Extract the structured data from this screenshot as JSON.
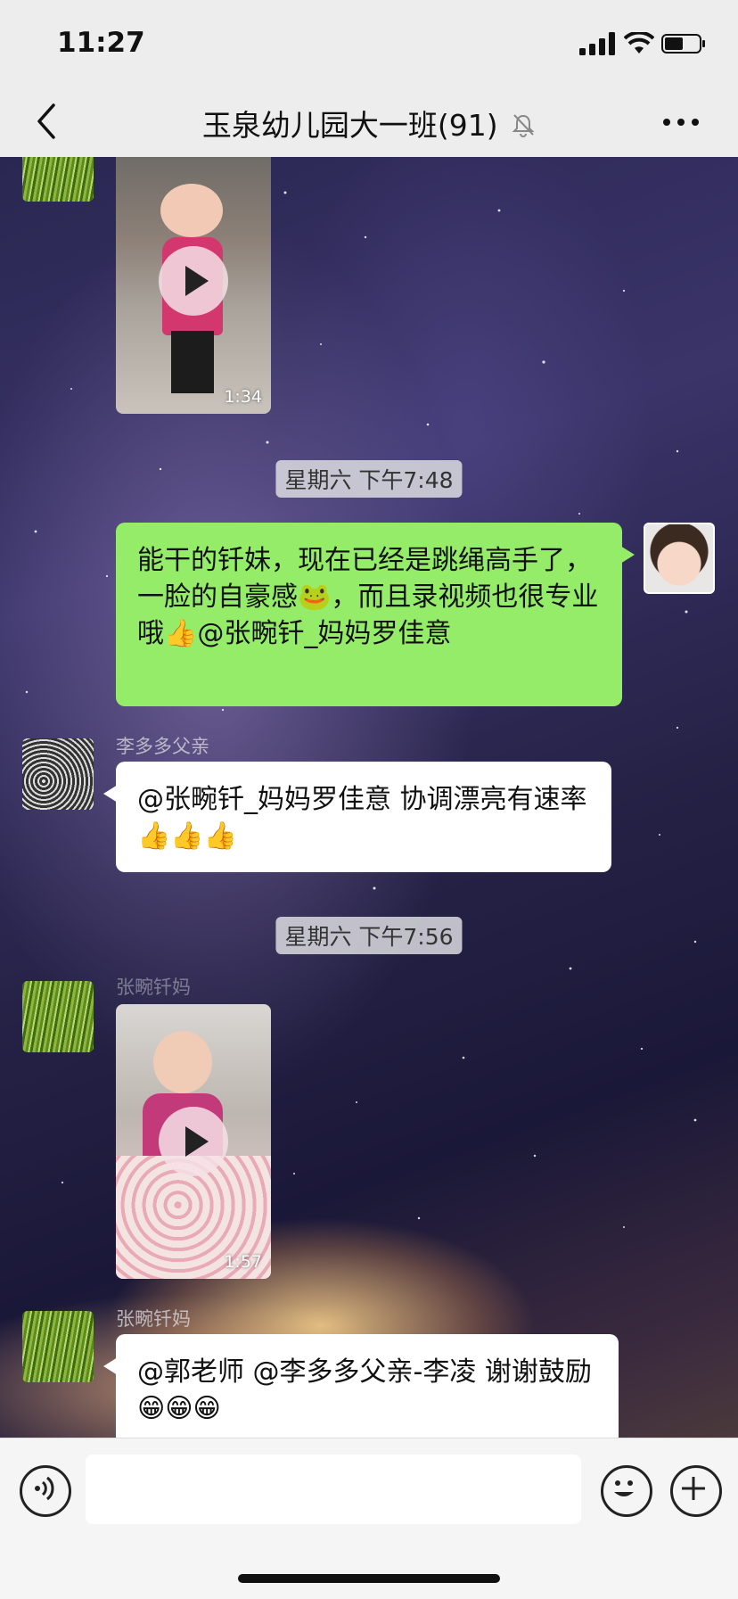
{
  "status_bar": {
    "time": "11:27"
  },
  "header": {
    "title": "玉泉幼儿园大一班(91)"
  },
  "messages": {
    "video1": {
      "duration": "1:34"
    },
    "timestamp1": "星期六 下午7:48",
    "out1": {
      "text": "能干的钎妹，现在已经是跳绳高手了，一脸的自豪感",
      "text2": "，而且录视频也很专业哦",
      "text3": "@张畹钎_妈妈罗佳意"
    },
    "in1": {
      "sender": "李多多父亲",
      "text": "@张畹钎_妈妈罗佳意 协调漂亮有速率"
    },
    "timestamp2": "星期六 下午7:56",
    "video2": {
      "sender": "张畹钎妈",
      "duration": "1:57"
    },
    "in2": {
      "sender": "张畹钎妈",
      "text": "@郭老师 @李多多父亲-李凌 谢谢鼓励"
    }
  },
  "icons": [
    "signal-icon",
    "wifi-icon",
    "battery-icon",
    "back-icon",
    "mute-icon",
    "more-icon",
    "play-icon",
    "voice-icon",
    "emoji-icon",
    "plus-icon",
    "thumbs-up-icon",
    "grin-icon",
    "frog-icon"
  ],
  "colors": {
    "bar_bg": "#ededed",
    "bubble_out": "#95ec69",
    "bubble_in": "#ffffff"
  }
}
